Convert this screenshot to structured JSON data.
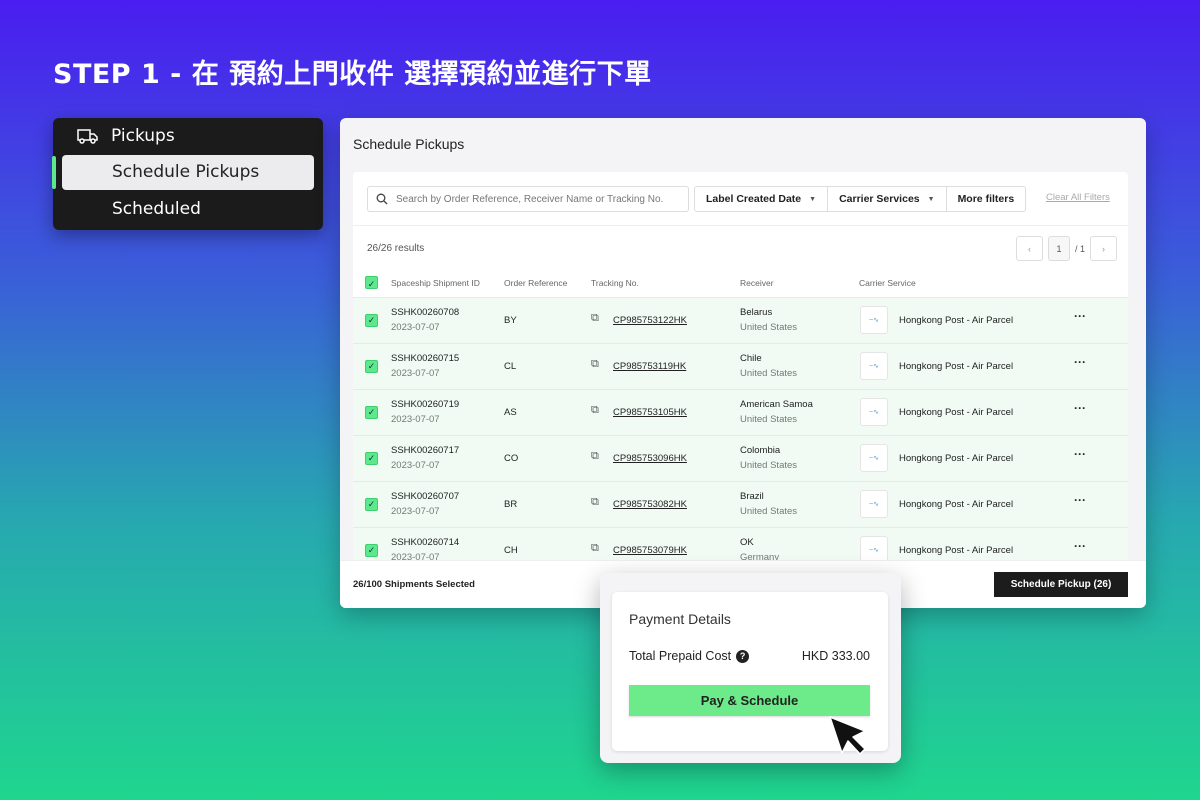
{
  "title": "STEP 1 - 在 預約上門收件 選擇預約並進行下單",
  "sidebar": {
    "section": "Pickups",
    "items": [
      {
        "label": "Schedule Pickups",
        "active": true
      },
      {
        "label": "Scheduled",
        "active": false
      }
    ]
  },
  "accent": "#5ee88c",
  "panel": {
    "title": "Schedule Pickups",
    "search_placeholder": "Search by Order Reference, Receiver Name or Tracking No.",
    "filters": [
      "Label Created Date",
      "Carrier Services",
      "More filters"
    ],
    "clear_filters": "Clear All Filters",
    "results": "26/26 results",
    "page": "1",
    "page_total": "/ 1",
    "columns": [
      "Spaceship Shipment ID",
      "Order Reference",
      "Tracking No.",
      "Receiver",
      "Carrier Service"
    ],
    "rows": [
      {
        "id": "SSHK00260708",
        "date": "2023-07-07",
        "ref": "BY",
        "tracking": "CP985753122HK",
        "receiver": "Belarus",
        "country": "United States",
        "carrier": "Hongkong Post - Air Parcel"
      },
      {
        "id": "SSHK00260715",
        "date": "2023-07-07",
        "ref": "CL",
        "tracking": "CP985753119HK",
        "receiver": "Chile",
        "country": "United States",
        "carrier": "Hongkong Post - Air Parcel"
      },
      {
        "id": "SSHK00260719",
        "date": "2023-07-07",
        "ref": "AS",
        "tracking": "CP985753105HK",
        "receiver": "American Samoa",
        "country": "United States",
        "carrier": "Hongkong Post - Air Parcel"
      },
      {
        "id": "SSHK00260717",
        "date": "2023-07-07",
        "ref": "CO",
        "tracking": "CP985753096HK",
        "receiver": "Colombia",
        "country": "United States",
        "carrier": "Hongkong Post - Air Parcel"
      },
      {
        "id": "SSHK00260707",
        "date": "2023-07-07",
        "ref": "BR",
        "tracking": "CP985753082HK",
        "receiver": "Brazil",
        "country": "United States",
        "carrier": "Hongkong Post - Air Parcel"
      },
      {
        "id": "SSHK00260714",
        "date": "2023-07-07",
        "ref": "CH",
        "tracking": "CP985753079HK",
        "receiver": "OK",
        "country": "Germany",
        "carrier": "Hongkong Post - Air Parcel"
      }
    ],
    "selected": "26/100 Shipments Selected",
    "schedule_button": "Schedule Pickup (26)"
  },
  "payment": {
    "title": "Payment Details",
    "label": "Total Prepaid Cost",
    "amount": "HKD 333.00",
    "button": "Pay & Schedule"
  }
}
